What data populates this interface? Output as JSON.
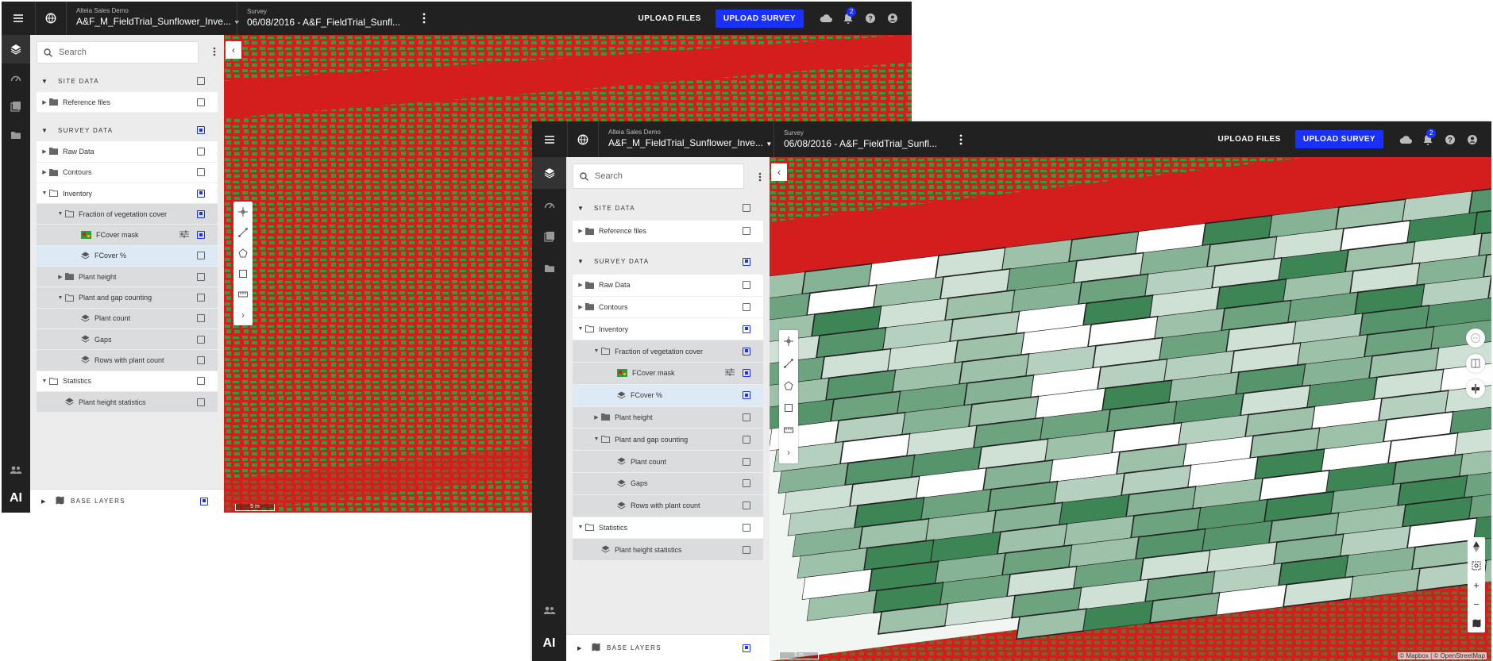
{
  "app": {
    "org": "Alteia Sales Demo",
    "project": "A&F_M_FieldTrial_Sunflower_Inve...",
    "survey_label": "Survey",
    "survey": "06/08/2016 - A&F_FieldTrial_Sunfl...",
    "upload_files": "UPLOAD FILES",
    "upload_survey": "UPLOAD SURVEY",
    "notif_count": "2",
    "logo": "AI"
  },
  "panel": {
    "search_placeholder": "Search",
    "site_data": "SITE DATA",
    "survey_data": "SURVEY DATA",
    "base_layers": "BASE LAYERS",
    "items": {
      "reference_files": "Reference files",
      "raw_data": "Raw Data",
      "contours": "Contours",
      "inventory": "Inventory",
      "fraction": "Fraction of vegetation cover",
      "fcover_mask": "FCover mask",
      "fcover_pct": "FCover %",
      "plant_height": "Plant height",
      "plant_gap": "Plant and gap counting",
      "plant_count": "Plant count",
      "gaps": "Gaps",
      "rows_with": "Rows with plant count",
      "statistics": "Statistics",
      "plant_height_stats": "Plant height statistics"
    }
  },
  "map": {
    "scale_w1": "5 m",
    "scale_w2": "5 m",
    "attribution": "© Mapbox | © OpenStreetMap"
  },
  "colors": {
    "accent": "#1a30ff",
    "topbar": "#212121",
    "ndvi_red": "#d41e1e",
    "ndvi_green": "#2e9e3c"
  }
}
